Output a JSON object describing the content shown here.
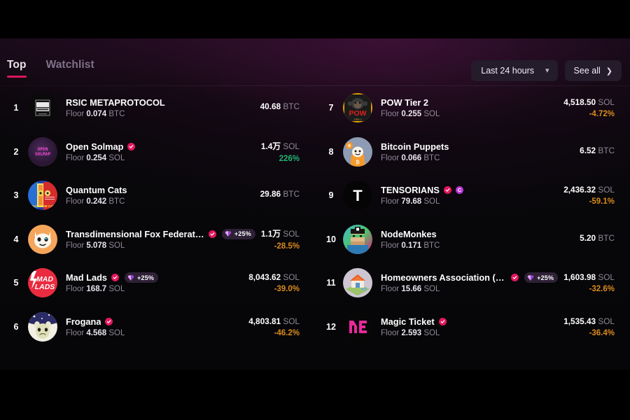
{
  "header": {
    "tabs": [
      {
        "label": "Top",
        "active": true
      },
      {
        "label": "Watchlist",
        "active": false
      }
    ],
    "range_label": "Last 24 hours",
    "range_chevron": "chevron-down-icon",
    "see_all_label": "See all",
    "see_all_arrow": "chevron-right-icon"
  },
  "floor_label": "Floor",
  "collections": [
    {
      "rank": "1",
      "name": "RSIC METAPROTOCOL",
      "verified": false,
      "c_badge": false,
      "gem_pill": null,
      "floor_value": "0.074",
      "floor_unit": "BTC",
      "volume_value": "40.68",
      "volume_unit": "BTC",
      "change": "",
      "change_dir": "none",
      "avatar": "rsic-metaprotocol-avatar"
    },
    {
      "rank": "2",
      "name": "Open Solmap",
      "verified": true,
      "c_badge": false,
      "gem_pill": null,
      "floor_value": "0.254",
      "floor_unit": "SOL",
      "volume_value": "1.4万",
      "volume_unit": "SOL",
      "change": "226%",
      "change_dir": "up",
      "avatar": "open-solmap-avatar"
    },
    {
      "rank": "3",
      "name": "Quantum Cats",
      "verified": false,
      "c_badge": false,
      "gem_pill": null,
      "floor_value": "0.242",
      "floor_unit": "BTC",
      "volume_value": "29.86",
      "volume_unit": "BTC",
      "change": "",
      "change_dir": "none",
      "avatar": "quantum-cats-avatar"
    },
    {
      "rank": "4",
      "name": "Transdimensional Fox Federation",
      "verified": true,
      "c_badge": false,
      "gem_pill": "+25%",
      "floor_value": "5.078",
      "floor_unit": "SOL",
      "volume_value": "1.1万",
      "volume_unit": "SOL",
      "change": "-28.5%",
      "change_dir": "down",
      "avatar": "transdimensional-fox-federation-avatar"
    },
    {
      "rank": "5",
      "name": "Mad Lads",
      "verified": true,
      "c_badge": false,
      "gem_pill": "+25%",
      "floor_value": "168.7",
      "floor_unit": "SOL",
      "volume_value": "8,043.62",
      "volume_unit": "SOL",
      "change": "-39.0%",
      "change_dir": "down",
      "avatar": "mad-lads-avatar"
    },
    {
      "rank": "6",
      "name": "Frogana",
      "verified": true,
      "c_badge": false,
      "gem_pill": null,
      "floor_value": "4.568",
      "floor_unit": "SOL",
      "volume_value": "4,803.81",
      "volume_unit": "SOL",
      "change": "-46.2%",
      "change_dir": "down",
      "avatar": "frogana-avatar"
    },
    {
      "rank": "7",
      "name": "POW Tier 2",
      "verified": false,
      "c_badge": false,
      "gem_pill": null,
      "floor_value": "0.255",
      "floor_unit": "SOL",
      "volume_value": "4,518.50",
      "volume_unit": "SOL",
      "change": "-4.72%",
      "change_dir": "down",
      "avatar": "pow-tier-2-avatar"
    },
    {
      "rank": "8",
      "name": "Bitcoin Puppets",
      "verified": false,
      "c_badge": false,
      "gem_pill": null,
      "floor_value": "0.066",
      "floor_unit": "BTC",
      "volume_value": "6.52",
      "volume_unit": "BTC",
      "change": "",
      "change_dir": "none",
      "avatar": "bitcoin-puppets-avatar"
    },
    {
      "rank": "9",
      "name": "TENSORIANS",
      "verified": true,
      "c_badge": true,
      "gem_pill": null,
      "floor_value": "79.68",
      "floor_unit": "SOL",
      "volume_value": "2,436.32",
      "volume_unit": "SOL",
      "change": "-59.1%",
      "change_dir": "down",
      "avatar": "tensorians-avatar"
    },
    {
      "rank": "10",
      "name": "NodeMonkes",
      "verified": false,
      "c_badge": false,
      "gem_pill": null,
      "floor_value": "0.171",
      "floor_unit": "BTC",
      "volume_value": "5.20",
      "volume_unit": "BTC",
      "change": "",
      "change_dir": "none",
      "avatar": "nodemonkes-avatar"
    },
    {
      "rank": "11",
      "name": "Homeowners Association (Parcl)",
      "verified": true,
      "c_badge": false,
      "gem_pill": "+25%",
      "floor_value": "15.66",
      "floor_unit": "SOL",
      "volume_value": "1,603.98",
      "volume_unit": "SOL",
      "change": "-32.6%",
      "change_dir": "down",
      "avatar": "homeowners-association-avatar"
    },
    {
      "rank": "12",
      "name": "Magic Ticket",
      "verified": true,
      "c_badge": false,
      "gem_pill": null,
      "floor_value": "2.593",
      "floor_unit": "SOL",
      "volume_value": "1,535.43",
      "volume_unit": "SOL",
      "change": "-36.4%",
      "change_dir": "down",
      "avatar": "magic-ticket-avatar"
    }
  ],
  "colors": {
    "accent": "#e8175d",
    "verified": "#e4175e",
    "c_badge": "#b735d6",
    "up": "#21b573",
    "down": "#d98b1c",
    "chip_bg": "#241b2b"
  }
}
